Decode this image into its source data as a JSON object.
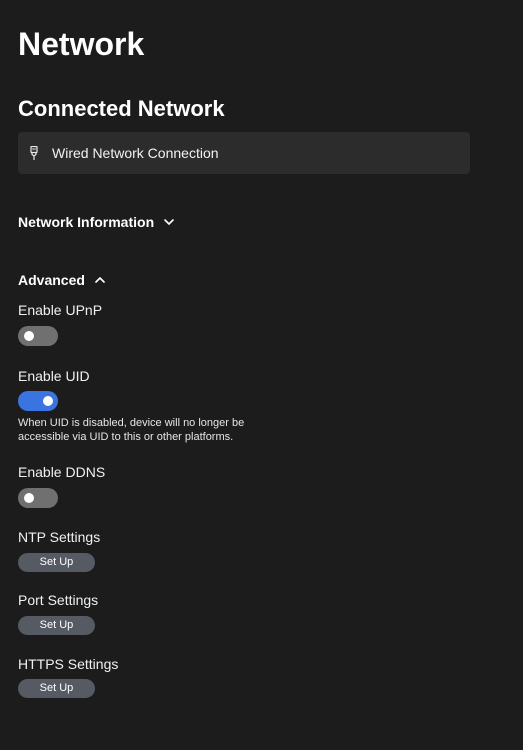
{
  "page": {
    "title": "Network"
  },
  "connected": {
    "heading": "Connected Network",
    "connection_label": "Wired Network Connection",
    "icon": "ethernet-plug-icon"
  },
  "network_information": {
    "label": "Network Information",
    "expanded": false,
    "icon": "chevron-down-icon"
  },
  "advanced": {
    "label": "Advanced",
    "expanded": true,
    "icon": "chevron-up-icon"
  },
  "settings": {
    "upnp": {
      "label": "Enable UPnP",
      "enabled": false
    },
    "uid": {
      "label": "Enable UID",
      "enabled": true,
      "hint": "When UID is disabled, device will no longer be accessible via UID to this or other platforms."
    },
    "ddns": {
      "label": "Enable DDNS",
      "enabled": false
    },
    "ntp": {
      "label": "NTP Settings",
      "button": "Set Up"
    },
    "port": {
      "label": "Port Settings",
      "button": "Set Up"
    },
    "https": {
      "label": "HTTPS Settings",
      "button": "Set Up"
    }
  },
  "colors": {
    "background": "#1c1c1c",
    "card": "#2c2c2c",
    "toggle_on": "#3a74e0",
    "toggle_off": "#707070",
    "button": "#555a63"
  }
}
